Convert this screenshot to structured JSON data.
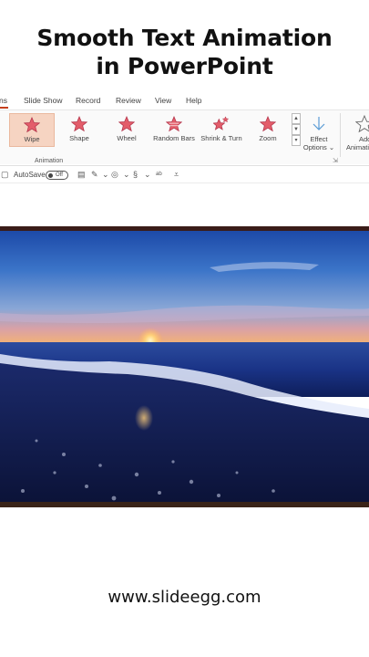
{
  "header": {
    "title_line1": "Smooth Text Animation",
    "title_line2": "in PowerPoint"
  },
  "ribbon": {
    "tabs": [
      {
        "label": "ns"
      },
      {
        "label": "Slide Show"
      },
      {
        "label": "Record"
      },
      {
        "label": "Review"
      },
      {
        "label": "View"
      },
      {
        "label": "Help"
      }
    ],
    "animations": [
      {
        "label": "Wipe",
        "icon": "wipe-star-icon",
        "selected": true
      },
      {
        "label": "Shape",
        "icon": "shape-star-icon"
      },
      {
        "label": "Wheel",
        "icon": "wheel-star-icon"
      },
      {
        "label": "Random Bars",
        "icon": "random-bars-star-icon"
      },
      {
        "label": "Shrink & Turn",
        "icon": "shrink-turn-star-icon"
      },
      {
        "label": "Zoom",
        "icon": "zoom-star-icon"
      }
    ],
    "effect_options_line1": "Effect",
    "effect_options_line2": "Options ⌄",
    "add_animation_line1": "Add",
    "add_animation_line2": "Animati",
    "group_label": "Animation",
    "accent_color": "#c43e1c",
    "star_color": "#e35d6a"
  },
  "qat": {
    "autosave_label": "AutoSave",
    "toggle_label": "Off"
  },
  "footer": {
    "url": "www.slideegg.com"
  }
}
